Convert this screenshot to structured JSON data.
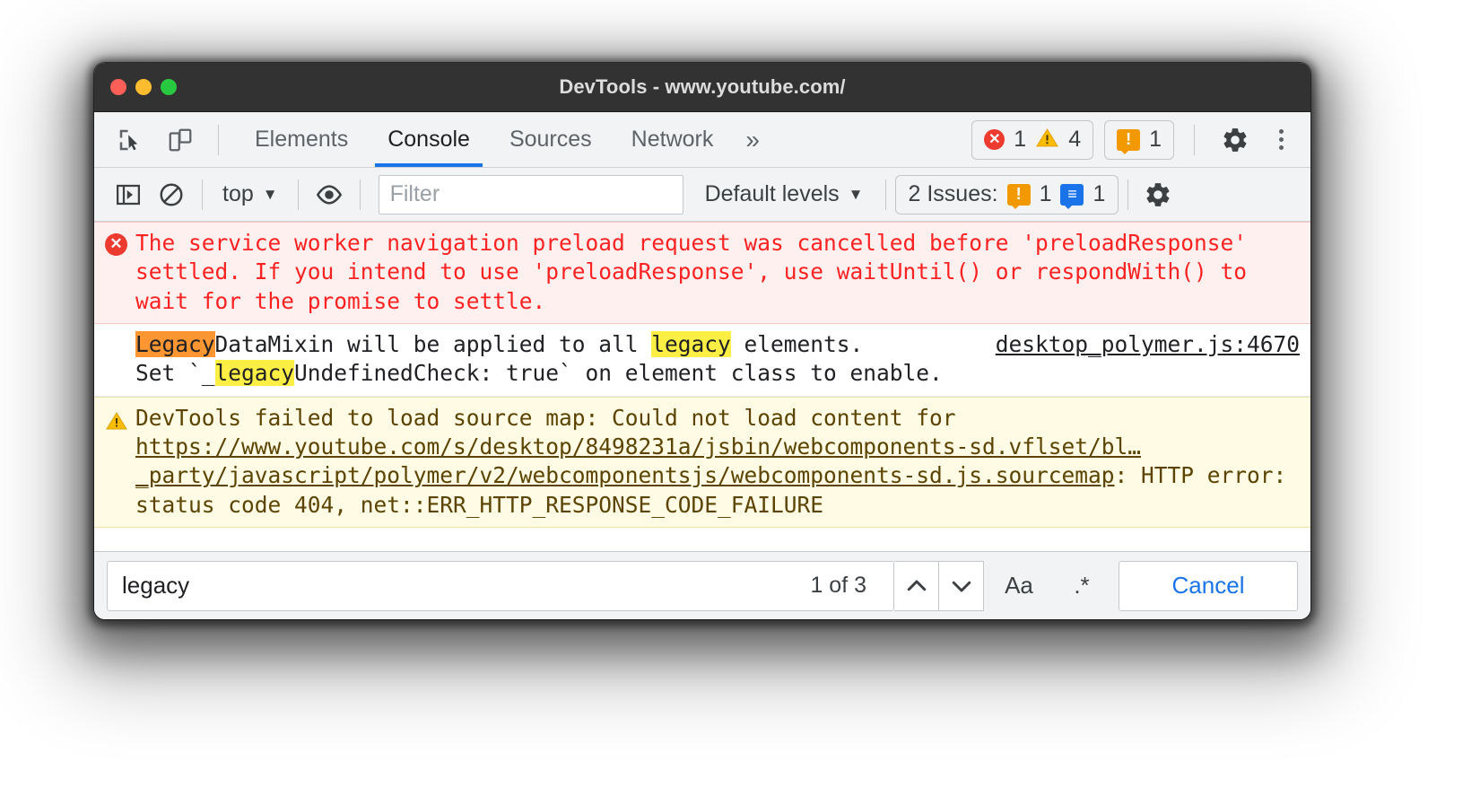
{
  "window": {
    "title": "DevTools - www.youtube.com/",
    "traffic_lights": [
      "close",
      "minimize",
      "maximize"
    ]
  },
  "toolbar": {
    "inspect_icon": "inspect-cursor-icon",
    "device_icon": "device-toolbar-icon",
    "tabs": [
      {
        "label": "Elements",
        "active": false
      },
      {
        "label": "Console",
        "active": true
      },
      {
        "label": "Sources",
        "active": false
      },
      {
        "label": "Network",
        "active": false
      }
    ],
    "more_tabs_icon": "chevron-double-right-icon",
    "error_count": "1",
    "warning_count": "4",
    "issue_count": "1",
    "settings_icon": "gear-icon",
    "menu_icon": "kebab-menu-icon"
  },
  "console_toolbar": {
    "sidebar_icon": "console-sidebar-icon",
    "clear_icon": "clear-console-icon",
    "context": "top",
    "eye_icon": "live-expression-icon",
    "filter_placeholder": "Filter",
    "filter_value": "",
    "levels": "Default levels",
    "issues_label": "2 Issues:",
    "issues_orange_count": "1",
    "issues_blue_count": "1",
    "console_settings_icon": "gear-icon"
  },
  "messages": [
    {
      "type": "error",
      "icon": "error-circle-icon",
      "text": "The service worker navigation preload request was cancelled before 'preloadResponse' settled. If you intend to use 'preloadResponse', use waitUntil() or respondWith() to wait for the promise to settle."
    },
    {
      "type": "log",
      "part_1_highlight": "Legacy",
      "part_2": "DataMixin will be applied to all ",
      "part_3_highlight": "legacy",
      "part_4": " elements.",
      "line2_pre": "Set `_",
      "line2_highlight": "legacy",
      "line2_post": "UndefinedCheck: true` on element class to enable.",
      "source_link": "desktop_polymer.js:4670"
    },
    {
      "type": "warning",
      "icon": "warning-triangle-icon",
      "prefix": "DevTools failed to load source map: Could not load content for ",
      "url": "https://www.youtube.com/s/desktop/8498231a/jsbin/webcomponents-sd.vflset/bl…_party/javascript/polymer/v2/webcomponentsjs/webcomponents-sd.js.sourcemap",
      "suffix": ": HTTP error: status code 404, net::ERR_HTTP_RESPONSE_CODE_FAILURE"
    }
  ],
  "search": {
    "value": "legacy",
    "matches": "1 of 3",
    "prev_icon": "chevron-up-icon",
    "next_icon": "chevron-down-icon",
    "match_case_label": "Aa",
    "regex_label": ".*",
    "cancel_label": "Cancel"
  },
  "colors": {
    "accent": "#1a73e8",
    "error": "#ee3b30",
    "warning": "#f29900",
    "highlight_active": "#ff9632",
    "highlight": "#ffee44"
  }
}
